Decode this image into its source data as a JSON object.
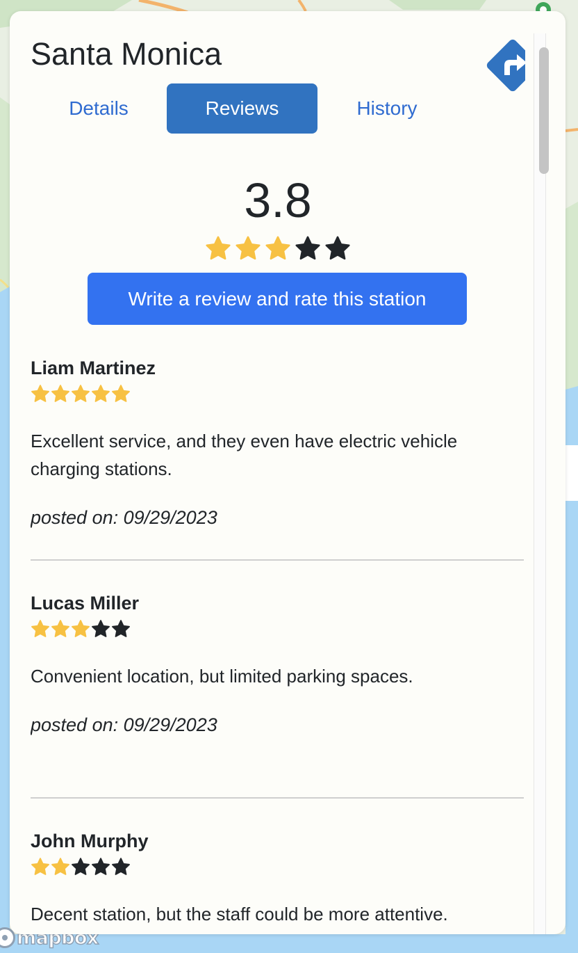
{
  "map": {
    "attribution_logo": "mapbox",
    "colors": {
      "land": "#e9efe3",
      "park": "#cfe4c6",
      "water": "#a9d6f5",
      "road_major": "#f3b36b"
    }
  },
  "panel": {
    "station_name": "Santa Monica",
    "directions_icon": "turn-right-arrow-icon",
    "tabs": [
      {
        "label": "Details",
        "active": false
      },
      {
        "label": "Reviews",
        "active": true
      },
      {
        "label": "History",
        "active": false
      }
    ],
    "overall_rating": "3.8",
    "overall_stars": {
      "filled": 3,
      "total": 5
    },
    "write_review_label": "Write a review and rate this station",
    "colors": {
      "star_filled": "#f7c143",
      "star_empty": "#212529",
      "tab_active_bg": "#3173c0",
      "primary_button": "#3372f0",
      "link": "#2f6bd0"
    }
  },
  "reviews": [
    {
      "name": "Liam Martinez",
      "stars": 5,
      "text": "Excellent service, and they even have electric vehicle charging stations.",
      "date": "posted on: 09/29/2023"
    },
    {
      "name": "Lucas Miller",
      "stars": 3,
      "text": "Convenient location, but limited parking spaces.",
      "date": "posted on: 09/29/2023"
    },
    {
      "name": "John Murphy",
      "stars": 2,
      "text": "Decent station, but the staff could be more attentive.",
      "date": ""
    }
  ]
}
